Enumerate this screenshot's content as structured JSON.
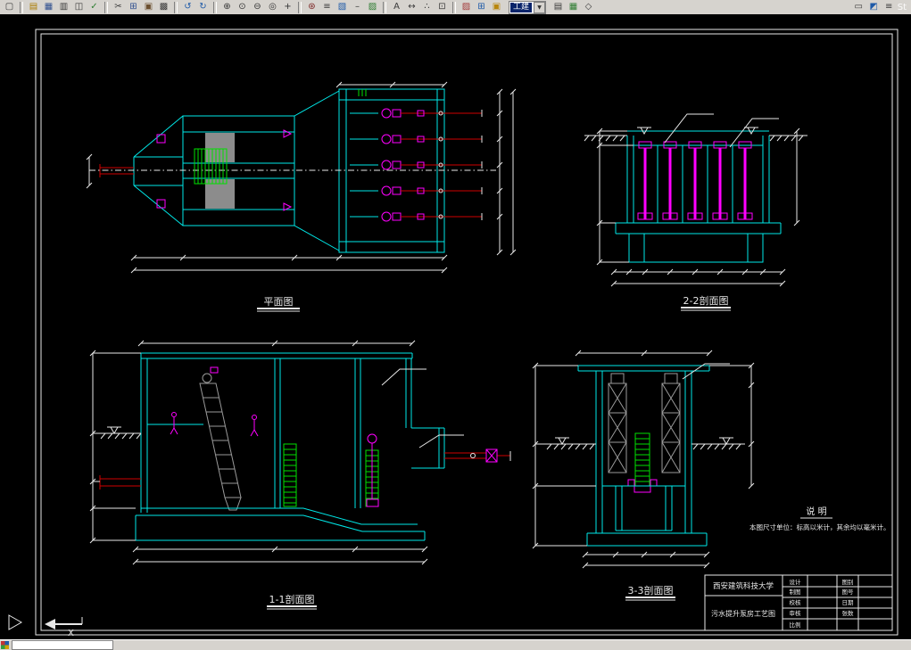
{
  "window": {
    "corner_text": "St"
  },
  "toolbar": {
    "layer_value": "工建",
    "dropdown_arrow": "▼",
    "groups_left": [
      {
        "icons": [
          {
            "name": "new-drawing",
            "glyph": "▢",
            "color": "#3a3a3a"
          }
        ]
      },
      {
        "icons": [
          {
            "name": "open-drawing",
            "glyph": "▤",
            "color": "#a97b00"
          },
          {
            "name": "save-drawing",
            "glyph": "▦",
            "color": "#2f4f8f"
          },
          {
            "name": "print",
            "glyph": "▥",
            "color": "#3a3a3a"
          },
          {
            "name": "print-preview",
            "glyph": "◫",
            "color": "#3a3a3a"
          },
          {
            "name": "spell-check",
            "glyph": "✓",
            "color": "#2e7d32"
          }
        ]
      },
      {
        "icons": [
          {
            "name": "cut",
            "glyph": "✂",
            "color": "#3a3a3a"
          },
          {
            "name": "copy",
            "glyph": "⊞",
            "color": "#2f4f8f"
          },
          {
            "name": "paste",
            "glyph": "▣",
            "color": "#6b4f2f"
          },
          {
            "name": "match-properties",
            "glyph": "▩",
            "color": "#3a3a3a"
          }
        ]
      },
      {
        "icons": [
          {
            "name": "undo",
            "glyph": "↺",
            "color": "#1e5aa8"
          },
          {
            "name": "redo",
            "glyph": "↻",
            "color": "#1e5aa8"
          }
        ]
      },
      {
        "icons": [
          {
            "name": "zoom-window",
            "glyph": "⊕",
            "color": "#333333"
          },
          {
            "name": "zoom-realtime",
            "glyph": "⊙",
            "color": "#333333"
          },
          {
            "name": "zoom-out",
            "glyph": "⊖",
            "color": "#333333"
          },
          {
            "name": "zoom-extents",
            "glyph": "◎",
            "color": "#333333"
          },
          {
            "name": "pan",
            "glyph": "+",
            "color": "#333333"
          }
        ]
      },
      {
        "icons": [
          {
            "name": "redraw",
            "glyph": "⊛",
            "color": "#7a1f1f"
          },
          {
            "name": "layers",
            "glyph": "≡",
            "color": "#3a3a3a"
          },
          {
            "name": "layer-properties",
            "glyph": "▧",
            "color": "#1e5aa8"
          },
          {
            "name": "linetype",
            "glyph": "–",
            "color": "#3a3a3a"
          },
          {
            "name": "hatch",
            "glyph": "▨",
            "color": "#2e7d32"
          }
        ]
      },
      {
        "icons": [
          {
            "name": "text-style",
            "glyph": "A",
            "color": "#3a3a3a"
          },
          {
            "name": "dimension-style",
            "glyph": "↔",
            "color": "#3a3a3a"
          },
          {
            "name": "point-style",
            "glyph": "∴",
            "color": "#3a3a3a"
          },
          {
            "name": "units",
            "glyph": "⊡",
            "color": "#3a3a3a"
          }
        ]
      },
      {
        "icons": [
          {
            "name": "color-control",
            "glyph": "▨",
            "color": "#a33a3a"
          },
          {
            "name": "make-block",
            "glyph": "⊞",
            "color": "#1e5aa8"
          },
          {
            "name": "insert-block",
            "glyph": "▣",
            "color": "#b8860b"
          }
        ]
      }
    ],
    "groups_right": [
      {
        "icons": [
          {
            "name": "properties-palette",
            "glyph": "▤",
            "color": "#3a3a3a"
          },
          {
            "name": "design-center",
            "glyph": "▦",
            "color": "#2e7d32"
          },
          {
            "name": "object-snap",
            "glyph": "◇",
            "color": "#3a3a3a"
          }
        ]
      }
    ],
    "groups_far": [
      {
        "icons": [
          {
            "name": "named-views",
            "glyph": "▭",
            "color": "#3a3a3a"
          },
          {
            "name": "orbit",
            "glyph": "◩",
            "color": "#1e5aa8"
          },
          {
            "name": "toolbar-options",
            "glyph": "≡",
            "color": "#3a3a3a"
          }
        ]
      }
    ]
  },
  "drawing": {
    "labels": {
      "plan": "平面图",
      "section_2_2": "2-2剖面图",
      "section_1_1": "1-1剖面图",
      "section_3_3": "3-3剖面图"
    },
    "notes": {
      "title": "说 明",
      "body": "本图尺寸单位：标高以米计，其余均以毫米计。"
    },
    "ucs_x_label": "X"
  },
  "title_block": {
    "university": "西安建筑科技大学",
    "drawing_title": "污水提升泵房工艺图",
    "cells": {
      "design": "设计",
      "draft": "制图",
      "check": "校核",
      "review": "审核",
      "scale": "比例",
      "sheet_type": "图别",
      "sheet_no": "图号",
      "date": "日期",
      "sheets": "张数"
    }
  },
  "colors": {
    "cad_cyan": "#00e8e8",
    "cad_magenta": "#ff00ff",
    "cad_green": "#00e000",
    "cad_red": "#d00000",
    "cad_white": "#e8e8e8",
    "toolbar_bg": "#d6d3ce",
    "selection_blue": "#0a246a"
  }
}
